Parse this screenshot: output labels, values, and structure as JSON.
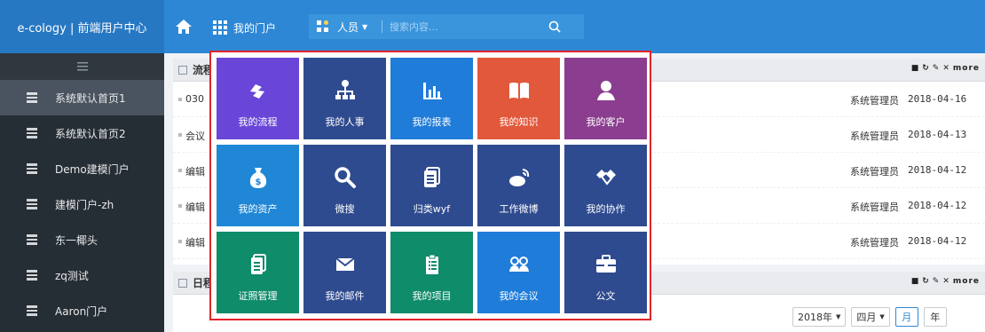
{
  "app": {
    "title": "e-cology | 前端用户中心"
  },
  "topbar": {
    "portal_label": "我的门户",
    "search_scope": "人员",
    "search_placeholder": "搜索内容..."
  },
  "sidebar": {
    "items": [
      {
        "label": "系统默认首页1"
      },
      {
        "label": "系统默认首页2"
      },
      {
        "label": "Demo建模门户"
      },
      {
        "label": "建模门户-zh"
      },
      {
        "label": "东一椰头"
      },
      {
        "label": "zq测试"
      },
      {
        "label": "Aaron门户"
      }
    ]
  },
  "panels": {
    "workflow": {
      "title": "流程",
      "tools": "more",
      "rows": [
        {
          "title": "030",
          "author": "系统管理员",
          "date": "2018-04-16"
        },
        {
          "title": "会议",
          "author": "系统管理员",
          "date": "2018-04-13"
        },
        {
          "title": "编辑",
          "author": "系统管理员",
          "date": "2018-04-12"
        },
        {
          "title": "编辑",
          "author": "系统管理员",
          "date": "2018-04-12"
        },
        {
          "title": "编辑",
          "author": "系统管理员",
          "date": "2018-04-12"
        }
      ]
    },
    "calendar": {
      "title": "日程",
      "tools": "more",
      "year": "2018年",
      "month": "四月",
      "month_btn": "月",
      "year_btn": "年"
    }
  },
  "tiles": [
    {
      "label": "我的流程",
      "color": "#6a46d8",
      "icon": "workflow-icon"
    },
    {
      "label": "我的人事",
      "color": "#2f4b8f",
      "icon": "org-chart-icon"
    },
    {
      "label": "我的报表",
      "color": "#1f7cd8",
      "icon": "bar-chart-icon"
    },
    {
      "label": "我的知识",
      "color": "#e2583a",
      "icon": "book-icon"
    },
    {
      "label": "我的客户",
      "color": "#8b3d8f",
      "icon": "user-icon"
    },
    {
      "label": "我的资产",
      "color": "#1f87d6",
      "icon": "money-bag-icon"
    },
    {
      "label": "微搜",
      "color": "#2f4b8f",
      "icon": "search-icon"
    },
    {
      "label": "归类wyf",
      "color": "#2f4b8f",
      "icon": "document-icon"
    },
    {
      "label": "工作微博",
      "color": "#2f4b8f",
      "icon": "weibo-icon"
    },
    {
      "label": "我的协作",
      "color": "#2f4b8f",
      "icon": "handshake-icon"
    },
    {
      "label": "证照管理",
      "color": "#0f8c6a",
      "icon": "certificate-icon"
    },
    {
      "label": "我的邮件",
      "color": "#2f4b8f",
      "icon": "mail-icon"
    },
    {
      "label": "我的项目",
      "color": "#0f8c6a",
      "icon": "clipboard-icon"
    },
    {
      "label": "我的会议",
      "color": "#1f7cd8",
      "icon": "meeting-icon"
    },
    {
      "label": "公文",
      "color": "#2f4b8f",
      "icon": "briefcase-icon"
    }
  ]
}
